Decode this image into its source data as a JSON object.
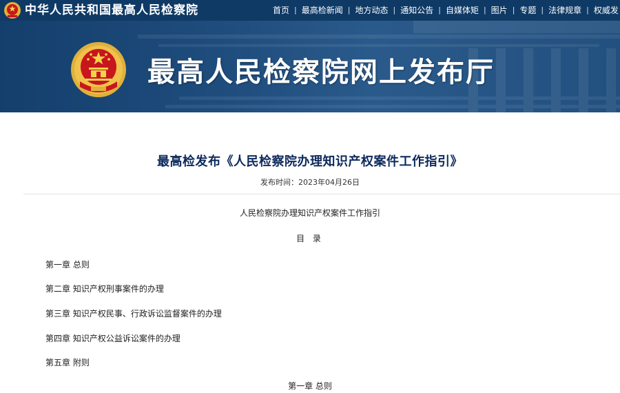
{
  "header": {
    "site_name": "中华人民共和国最高人民检察院",
    "nav": [
      "首页",
      "最高检新闻",
      "地方动态",
      "通知公告",
      "自媒体矩",
      "图片",
      "专题",
      "法律规章",
      "权威发"
    ]
  },
  "banner": {
    "title": "最高人民检察院网上发布厅"
  },
  "article": {
    "title": "最高检发布《人民检察院办理知识产权案件工作指引》",
    "date_label": "发布时间：2023年04月26日",
    "doc_title": "人民检察院办理知识产权案件工作指引",
    "toc_heading": "目 录",
    "toc": [
      "第一章 总则",
      "第二章 知识产权刑事案件的办理",
      "第三章 知识产权民事、行政诉讼监督案件的办理",
      "第四章 知识产权公益诉讼案件的办理",
      "第五章 附则"
    ],
    "chapter_heading": "第一章 总则"
  },
  "colors": {
    "topbar": "#0f3a66",
    "banner": "#1e4c7c",
    "title": "#0d2a5c",
    "emblem_red": "#c8161d",
    "emblem_gold": "#e0b13a"
  }
}
